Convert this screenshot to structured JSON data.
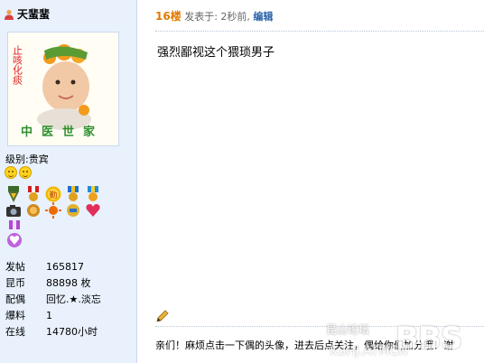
{
  "user": {
    "name": "天蜚蜚",
    "avatar_caption_top": "止咳化痰",
    "avatar_caption_bottom": "中医世家",
    "level_label": "级别:",
    "level_value": "贵宾",
    "stats": [
      {
        "label": "发帖",
        "value": "165817"
      },
      {
        "label": "昆币",
        "value": "88898 枚"
      },
      {
        "label": "配偶",
        "value": "回忆.★.淡忘"
      },
      {
        "label": "爆料",
        "value": "1"
      },
      {
        "label": "在线",
        "value": "14780小时"
      }
    ]
  },
  "post": {
    "floor": "16楼",
    "posted_label": "发表于:",
    "time": "2秒前",
    "separator": ",",
    "edit_label": "编辑",
    "content": "强烈鄙视这个猥琐男子",
    "signature": "亲们！麻烦点击一下偶的头像，进去后点关注，偶给你们加分哦！谢"
  },
  "watermark": {
    "small": "昆山论坛",
    "big": "BBS",
    "url": "KSHJ.ATMCN"
  },
  "colors": {
    "sidebar_bg": "#e8f1fc",
    "floor": "#e07a00",
    "link": "#2a62a9"
  }
}
